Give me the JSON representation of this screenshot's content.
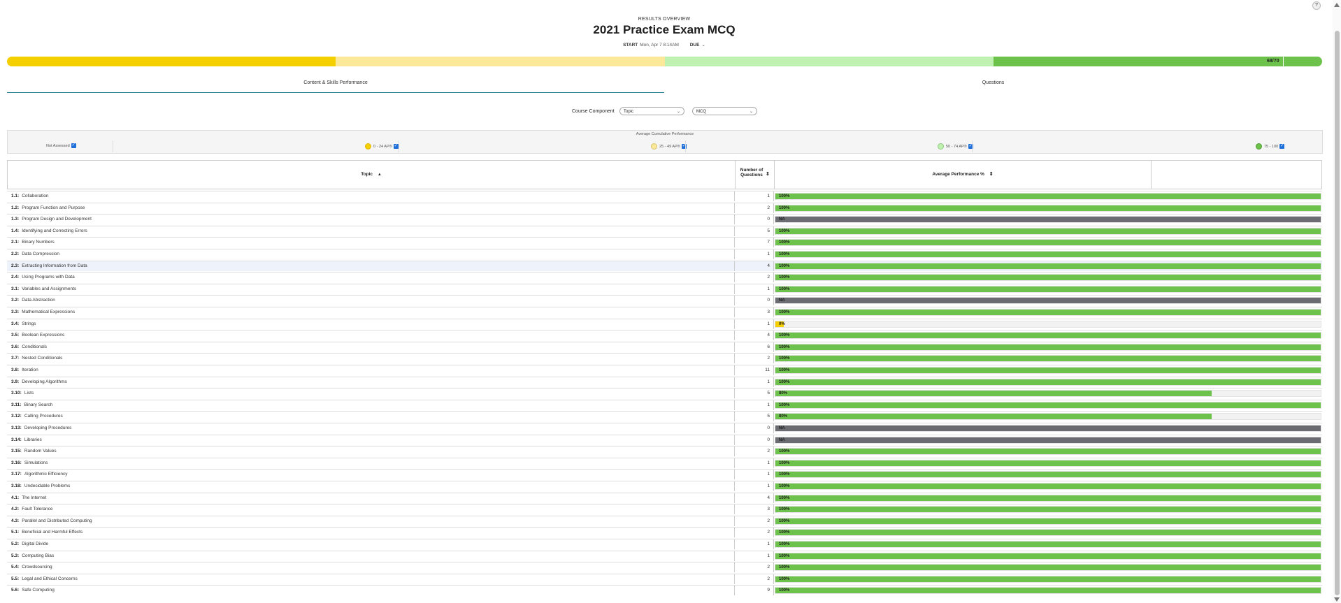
{
  "header": {
    "subtitle": "RESULTS OVERVIEW",
    "title": "2021 Practice Exam MCQ",
    "start_label": "START",
    "start_value": "Mon, Apr 7 8:14AM",
    "due_label": "DUE",
    "due_icon": "chevron-down-icon"
  },
  "progress": {
    "label": "68/70",
    "bands": [
      "#f5d000",
      "#fbe899",
      "#bff2b0",
      "#6cc24a"
    ],
    "score": 68,
    "total": 70
  },
  "tabs": [
    {
      "label": "Content & Skills Performance",
      "active": true
    },
    {
      "label": "Questions",
      "active": false
    }
  ],
  "filters": {
    "label": "Course Component",
    "topic_select": "Topic",
    "type_select": "MCQ"
  },
  "legend": {
    "title": "Average Cumulative Performance",
    "items": [
      {
        "label": "Not Assessed",
        "color": ""
      },
      {
        "label": "0 - 24 AP®",
        "color": "#f5d000"
      },
      {
        "label": "25 - 49 AP®",
        "color": "#fbe899"
      },
      {
        "label": "50 - 74 AP®",
        "color": "#bff2b0"
      },
      {
        "label": "75 - 100",
        "color": "#6cc24a"
      }
    ]
  },
  "table": {
    "columns": [
      "Topic",
      "Number of Questions",
      "Average Performance %"
    ],
    "rows": [
      {
        "code": "1.1:",
        "name": "Collaboration",
        "count": "1",
        "perf": "100%",
        "value": 100
      },
      {
        "code": "1.2:",
        "name": "Program Function and Purpose",
        "count": "2",
        "perf": "100%",
        "value": 100
      },
      {
        "code": "1.3:",
        "name": "Program Design and Development",
        "count": "0",
        "perf": "NA",
        "value": null
      },
      {
        "code": "1.4:",
        "name": "Identifying and Correcting Errors",
        "count": "5",
        "perf": "100%",
        "value": 100
      },
      {
        "code": "2.1:",
        "name": "Binary Numbers",
        "count": "7",
        "perf": "100%",
        "value": 100
      },
      {
        "code": "2.2:",
        "name": "Data Compression",
        "count": "1",
        "perf": "100%",
        "value": 100
      },
      {
        "code": "2.3:",
        "name": "Extracting Information from Data",
        "count": "4",
        "perf": "100%",
        "value": 100
      },
      {
        "code": "2.4:",
        "name": "Using Programs with Data",
        "count": "2",
        "perf": "100%",
        "value": 100
      },
      {
        "code": "3.1:",
        "name": "Variables and Assignments",
        "count": "1",
        "perf": "100%",
        "value": 100
      },
      {
        "code": "3.2:",
        "name": "Data Abstraction",
        "count": "0",
        "perf": "NA",
        "value": null
      },
      {
        "code": "3.3:",
        "name": "Mathematical Expressions",
        "count": "3",
        "perf": "100%",
        "value": 100
      },
      {
        "code": "3.4:",
        "name": "Strings",
        "count": "1",
        "perf": "0%",
        "value": 0
      },
      {
        "code": "3.5:",
        "name": "Boolean Expressions",
        "count": "4",
        "perf": "100%",
        "value": 100
      },
      {
        "code": "3.6:",
        "name": "Conditionals",
        "count": "6",
        "perf": "100%",
        "value": 100
      },
      {
        "code": "3.7:",
        "name": "Nested Conditionals",
        "count": "2",
        "perf": "100%",
        "value": 100
      },
      {
        "code": "3.8:",
        "name": "Iteration",
        "count": "11",
        "perf": "100%",
        "value": 100
      },
      {
        "code": "3.9:",
        "name": "Developing Algorithms",
        "count": "1",
        "perf": "100%",
        "value": 100
      },
      {
        "code": "3.10:",
        "name": "Lists",
        "count": "5",
        "perf": "80%",
        "value": 80
      },
      {
        "code": "3.11:",
        "name": "Binary Search",
        "count": "1",
        "perf": "100%",
        "value": 100
      },
      {
        "code": "3.12:",
        "name": "Calling Procedures",
        "count": "5",
        "perf": "80%",
        "value": 80
      },
      {
        "code": "3.13:",
        "name": "Developing Procedures",
        "count": "0",
        "perf": "NA",
        "value": null
      },
      {
        "code": "3.14:",
        "name": "Libraries",
        "count": "0",
        "perf": "NA",
        "value": null
      },
      {
        "code": "3.15:",
        "name": "Random Values",
        "count": "2",
        "perf": "100%",
        "value": 100
      },
      {
        "code": "3.16:",
        "name": "Simulations",
        "count": "1",
        "perf": "100%",
        "value": 100
      },
      {
        "code": "3.17:",
        "name": "Algorithmic Efficiency",
        "count": "1",
        "perf": "100%",
        "value": 100
      },
      {
        "code": "3.18:",
        "name": "Undecidable Problems",
        "count": "1",
        "perf": "100%",
        "value": 100
      },
      {
        "code": "4.1:",
        "name": "The Internet",
        "count": "4",
        "perf": "100%",
        "value": 100
      },
      {
        "code": "4.2:",
        "name": "Fault Tolerance",
        "count": "3",
        "perf": "100%",
        "value": 100
      },
      {
        "code": "4.3:",
        "name": "Parallel and Distributed Computing",
        "count": "2",
        "perf": "100%",
        "value": 100
      },
      {
        "code": "5.1:",
        "name": "Beneficial and Harmful Effects",
        "count": "2",
        "perf": "100%",
        "value": 100
      },
      {
        "code": "5.2:",
        "name": "Digital Divide",
        "count": "1",
        "perf": "100%",
        "value": 100
      },
      {
        "code": "5.3:",
        "name": "Computing Bias",
        "count": "1",
        "perf": "100%",
        "value": 100
      },
      {
        "code": "5.4:",
        "name": "Crowdsourcing",
        "count": "2",
        "perf": "100%",
        "value": 100
      },
      {
        "code": "5.5:",
        "name": "Legal and Ethical Concerns",
        "count": "2",
        "perf": "100%",
        "value": 100
      },
      {
        "code": "5.6:",
        "name": "Safe Computing",
        "count": "9",
        "perf": "100%",
        "value": 100
      }
    ]
  },
  "colors": {
    "high": "#6cc24a",
    "low": "#f5d000",
    "na": "#6b6b72",
    "accent": "#1f7a8c"
  }
}
